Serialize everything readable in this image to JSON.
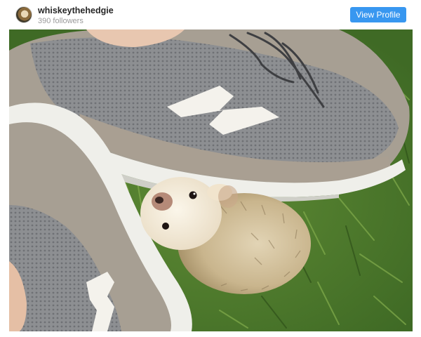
{
  "post": {
    "username": "whiskeythehedgie",
    "followers": "390 followers",
    "view_profile_label": "View Profile"
  },
  "colors": {
    "accent": "#3897f0",
    "username_text": "#262626",
    "muted_text": "#9a9a9a"
  },
  "icons": {
    "avatar": "hedgehog-avatar"
  }
}
